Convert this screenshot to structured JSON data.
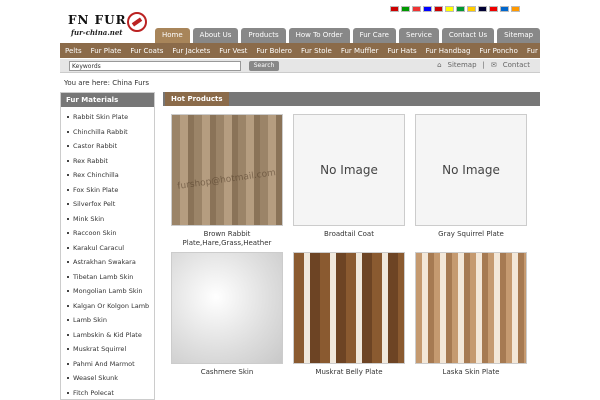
{
  "logo": {
    "title": "FN FUR",
    "subtitle": "fur-china.net"
  },
  "topnav": [
    "Home",
    "About Us",
    "Products",
    "How To Order",
    "Fur Care",
    "Service",
    "Contact Us",
    "Sitemap"
  ],
  "categories": [
    "Pelts",
    "Fur Plate",
    "Fur Coats",
    "Fur Jackets",
    "Fur Vest",
    "Fur Bolero",
    "Fur Stole",
    "Fur Muffler",
    "Fur Hats",
    "Fur Handbag",
    "Fur Poncho",
    "Fur Gilet"
  ],
  "search": {
    "value": "Keywords",
    "button": "Search",
    "sitemap": "Sitemap",
    "contact": "Contact",
    "separator": "|"
  },
  "breadcrumb": {
    "prefix": "You are here:",
    "current": "China Furs"
  },
  "sidebar": {
    "title": "Fur Materials",
    "items": [
      "Rabbit Skin Plate",
      "Chinchilla Rabbit",
      "Castor Rabbit",
      "Rex Rabbit",
      "Rex Chinchilla",
      "Fox Skin Plate",
      "Silverfox Pelt",
      "Mink Skin",
      "Raccoon Skin",
      "Karakul Caracul",
      "Astrakhan Swakara",
      "Tibetan Lamb Skin",
      "Mongolian Lamb Skin",
      "Kalgan Or Kolgon Lamb",
      "Lamb Skin",
      "Lambskin & Kid Plate",
      "Muskrat Squirrel",
      "Pahmi And Marmot",
      "Weasel Skunk",
      "Fitch Polecat"
    ]
  },
  "products": {
    "title": "Hot Products",
    "items": [
      {
        "name": "Brown Rabbit Plate,Hare,Grass,Heather",
        "image": "imgA",
        "watermark": "furshop@hotmail.com"
      },
      {
        "name": "Broadtail Coat",
        "image": "none",
        "placeholder": "No Image"
      },
      {
        "name": "Gray Squirrel Plate",
        "image": "none",
        "placeholder": "No Image"
      },
      {
        "name": "Cashmere Skin",
        "image": "imgB"
      },
      {
        "name": "Muskrat Belly Plate",
        "image": "imgC"
      },
      {
        "name": "Laska Skin Plate",
        "image": "imgD"
      }
    ]
  },
  "flags": [
    "#c00",
    "#090",
    "#e33",
    "#00f",
    "#c00",
    "#ff0",
    "#093",
    "#fc0",
    "#003",
    "#e00",
    "#06c",
    "#f90"
  ]
}
